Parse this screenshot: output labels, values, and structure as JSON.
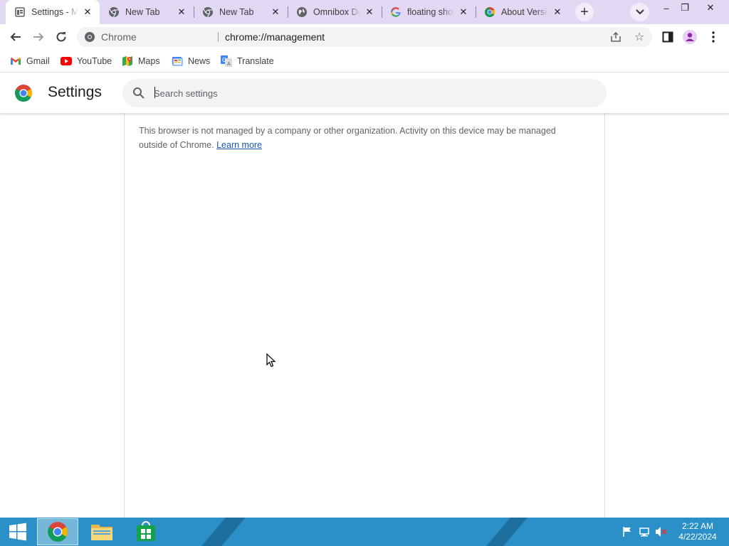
{
  "tabs": [
    {
      "title": "Settings - Management",
      "favicon": "settings-favicon",
      "active": true
    },
    {
      "title": "New Tab",
      "favicon": "chromium-favicon",
      "active": false
    },
    {
      "title": "New Tab",
      "favicon": "chromium-favicon",
      "active": false
    },
    {
      "title": "Omnibox Debug Page",
      "favicon": "globe-favicon",
      "active": false
    },
    {
      "title": "floating shopping",
      "favicon": "google-favicon",
      "active": false
    },
    {
      "title": "About Version",
      "favicon": "chrome-favicon",
      "active": false
    }
  ],
  "new_tab_label": "+",
  "window_controls": {
    "minimize": "–",
    "restore": "❐",
    "close": "✕"
  },
  "omnibox": {
    "chip": "Chrome",
    "url": "chrome://management"
  },
  "bookmarks": [
    {
      "label": "Gmail",
      "icon": "gmail-icon"
    },
    {
      "label": "YouTube",
      "icon": "youtube-icon"
    },
    {
      "label": "Maps",
      "icon": "maps-icon"
    },
    {
      "label": "News",
      "icon": "news-icon"
    },
    {
      "label": "Translate",
      "icon": "translate-icon"
    }
  ],
  "settings": {
    "title": "Settings",
    "search_placeholder": "Search settings"
  },
  "management": {
    "message": "This browser is not managed by a company or other organization. Activity on this device may be managed outside of Chrome.",
    "learn_more": "Learn more"
  },
  "taskbar": {
    "apps": [
      "start-icon",
      "chrome-icon",
      "file-explorer-icon",
      "store-icon"
    ],
    "clock_time": "2:22 AM",
    "clock_date": "4/22/2024"
  },
  "colors": {
    "tabstrip": "#e3d8f3",
    "taskbar": "#2b8fc8",
    "link": "#1558b0"
  }
}
